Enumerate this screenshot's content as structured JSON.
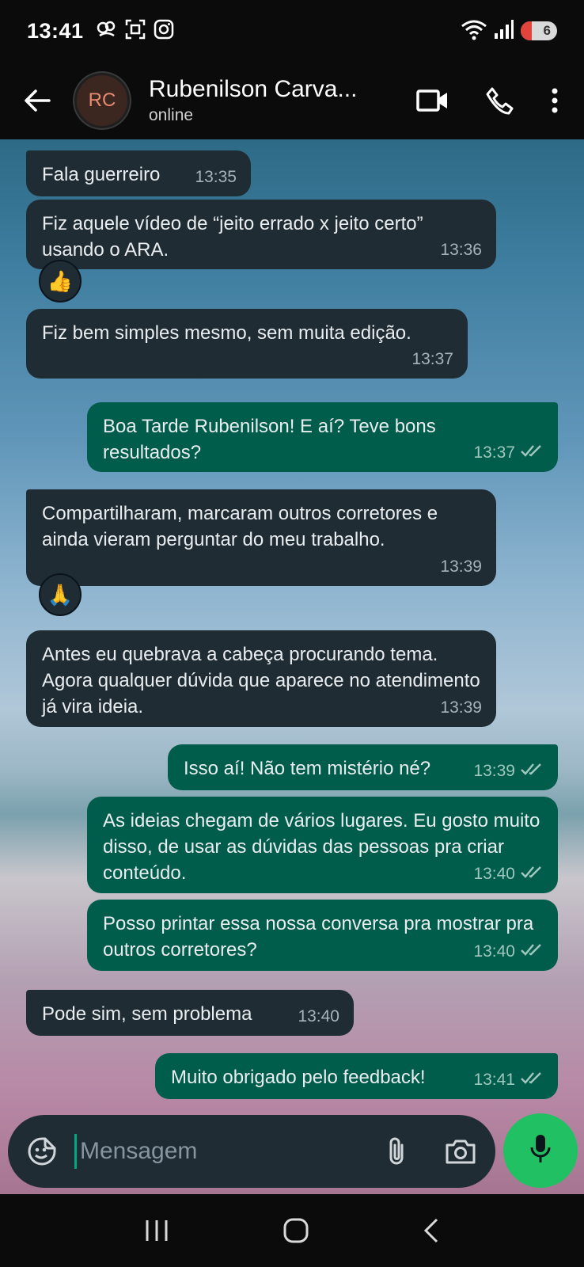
{
  "status_bar": {
    "time": "13:41",
    "battery_level": "6",
    "icons": [
      "face-icon",
      "screenshot-icon",
      "instagram-icon",
      "wifi-icon",
      "signal-icon",
      "battery-icon"
    ]
  },
  "header": {
    "avatar_initials": "RC",
    "contact_name": "Rubenilson Carva...",
    "status": "online"
  },
  "messages": [
    {
      "dir": "in",
      "text": "Fala guerreiro",
      "time": "13:35"
    },
    {
      "dir": "in",
      "text": "Fiz aquele vídeo de “jeito errado x jeito certo” usando o ARA.",
      "time": "13:36",
      "reaction": "👍"
    },
    {
      "dir": "in",
      "text": "Fiz bem simples mesmo, sem muita edição.",
      "time": "13:37"
    },
    {
      "dir": "out",
      "text": "Boa Tarde Rubenilson! E aí? Teve bons resultados?",
      "time": "13:37"
    },
    {
      "dir": "in",
      "text": "Compartilharam, marcaram outros corretores e ainda vieram perguntar do meu trabalho.",
      "time": "13:39",
      "reaction": "🙏"
    },
    {
      "dir": "in",
      "text": "Antes eu quebrava a cabeça procurando tema. Agora qualquer dúvida que aparece no atendimento já vira ideia.",
      "time": "13:39"
    },
    {
      "dir": "out",
      "text": "Isso aí! Não tem mistério né?",
      "time": "13:39"
    },
    {
      "dir": "out",
      "text": "As ideias chegam de vários lugares. Eu gosto muito disso, de usar as dúvidas das pessoas pra criar conteúdo.",
      "time": "13:40"
    },
    {
      "dir": "out",
      "text": "Posso printar essa nossa conversa pra mostrar pra outros corretores?",
      "time": "13:40"
    },
    {
      "dir": "in",
      "text": "Pode sim, sem problema",
      "time": "13:40"
    },
    {
      "dir": "out",
      "text": "Muito obrigado pelo feedback!",
      "time": "13:41"
    }
  ],
  "composer": {
    "placeholder": "Mensagem"
  },
  "colors": {
    "incoming_bubble": "#202c33",
    "outgoing_bubble": "#005c4b",
    "accent": "#21c063"
  }
}
